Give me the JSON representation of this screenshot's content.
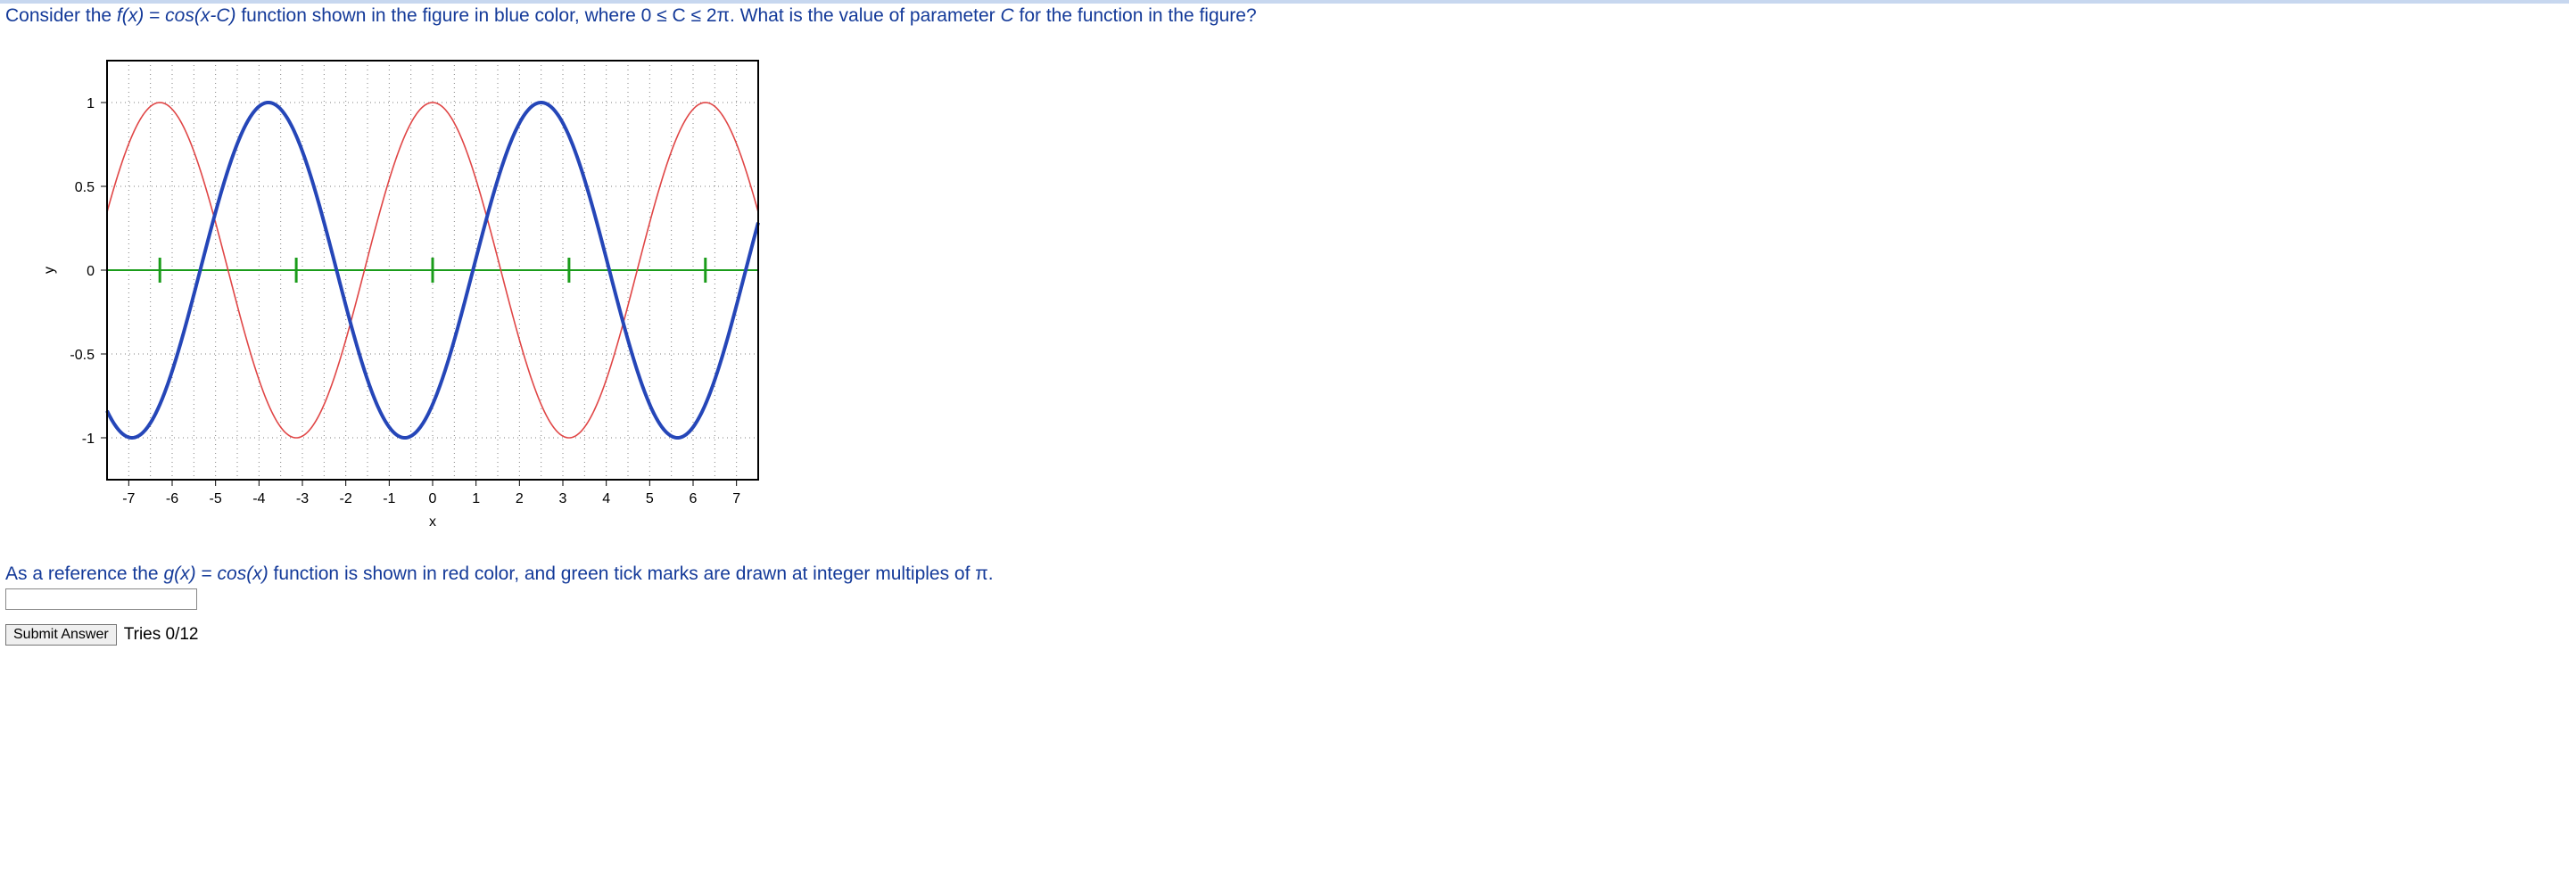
{
  "question": {
    "prefix": "Consider the ",
    "fx": "f(x)",
    "eq": " = ",
    "func": "cos(x-C)",
    "middle": " function shown in the figure in blue color, where 0 ≤ C ≤ 2π. What is the value of parameter ",
    "param": "C",
    "suffix": " for the function in the figure?"
  },
  "reference": {
    "prefix": "As a reference the ",
    "gx": "g(x)",
    "eq": " = ",
    "func": "cos(x)",
    "suffix": " function is shown in red color, and green tick marks are drawn at integer multiples of π."
  },
  "answer": {
    "value": "",
    "placeholder": ""
  },
  "submit": {
    "label": "Submit Answer",
    "tries": "Tries 0/12"
  },
  "chart_data": {
    "type": "line",
    "xlabel": "x",
    "ylabel": "y",
    "xlim": [
      -7.5,
      7.5
    ],
    "ylim": [
      -1.25,
      1.25
    ],
    "x_ticks": [
      -7,
      -6,
      -5,
      -4,
      -3,
      -2,
      -1,
      0,
      1,
      2,
      3,
      4,
      5,
      6,
      7
    ],
    "y_ticks": [
      -1,
      -0.5,
      0,
      0.5,
      1
    ],
    "green_marks_at_multiples_of_pi": [
      -2,
      -1,
      0,
      1,
      2
    ],
    "series": [
      {
        "name": "g(x) = cos(x)",
        "color": "#e04646",
        "type": "cos",
        "phase": 0,
        "amplitude": 1
      },
      {
        "name": "f(x) = cos(x - C)",
        "color": "#2546b8",
        "type": "cos",
        "phase": 2.5,
        "amplitude": 1
      }
    ]
  }
}
